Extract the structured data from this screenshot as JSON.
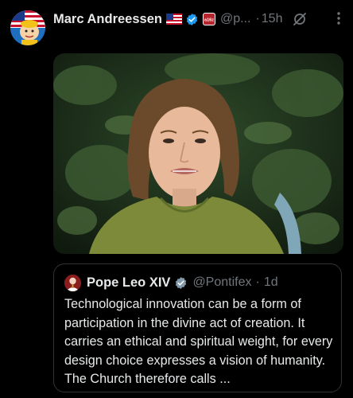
{
  "post": {
    "author_name": "Marc Andreessen",
    "flag_icon": "us-flag-icon",
    "handle": "@p...",
    "separator": "·",
    "time": "15h"
  },
  "quoted": {
    "author_name": "Pope Leo XIV",
    "handle": "@Pontifex",
    "separator": "·",
    "time": "1d",
    "text": "Technological innovation can be a form of participation in the divine act of creation. It carries an ethical and spiritual weight, for every design choice expresses a vision of humanity. The Church therefore calls ..."
  },
  "colors": {
    "background": "#000000",
    "text": "#e7e9ea",
    "muted": "#71767b",
    "verified": "#1d9bf0",
    "border": "#2f3336"
  }
}
